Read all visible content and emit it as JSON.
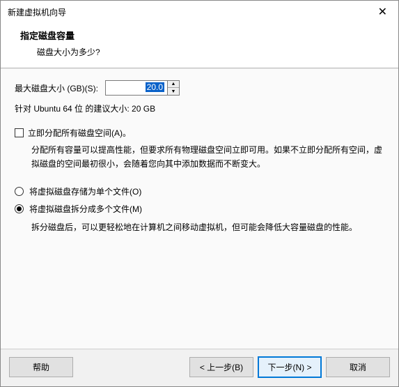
{
  "window": {
    "title": "新建虚拟机向导",
    "close_glyph": "✕"
  },
  "header": {
    "title": "指定磁盘容量",
    "question": "磁盘大小为多少?"
  },
  "size": {
    "label": "最大磁盘大小 (GB)(S):",
    "value": "20.0",
    "recommend": "针对 Ubuntu 64 位 的建议大小: 20 GB"
  },
  "allocate": {
    "label": "立即分配所有磁盘空间(A)。",
    "desc": "分配所有容量可以提高性能，但要求所有物理磁盘空间立即可用。如果不立即分配所有空间，虚拟磁盘的空间最初很小，会随着您向其中添加数据而不断变大。"
  },
  "split": {
    "option_single": "将虚拟磁盘存储为单个文件(O)",
    "option_multi": "将虚拟磁盘拆分成多个文件(M)",
    "selected": "multi",
    "desc": "拆分磁盘后，可以更轻松地在计算机之间移动虚拟机，但可能会降低大容量磁盘的性能。"
  },
  "footer": {
    "help": "帮助",
    "back": "< 上一步(B)",
    "next": "下一步(N) >",
    "cancel": "取消"
  }
}
